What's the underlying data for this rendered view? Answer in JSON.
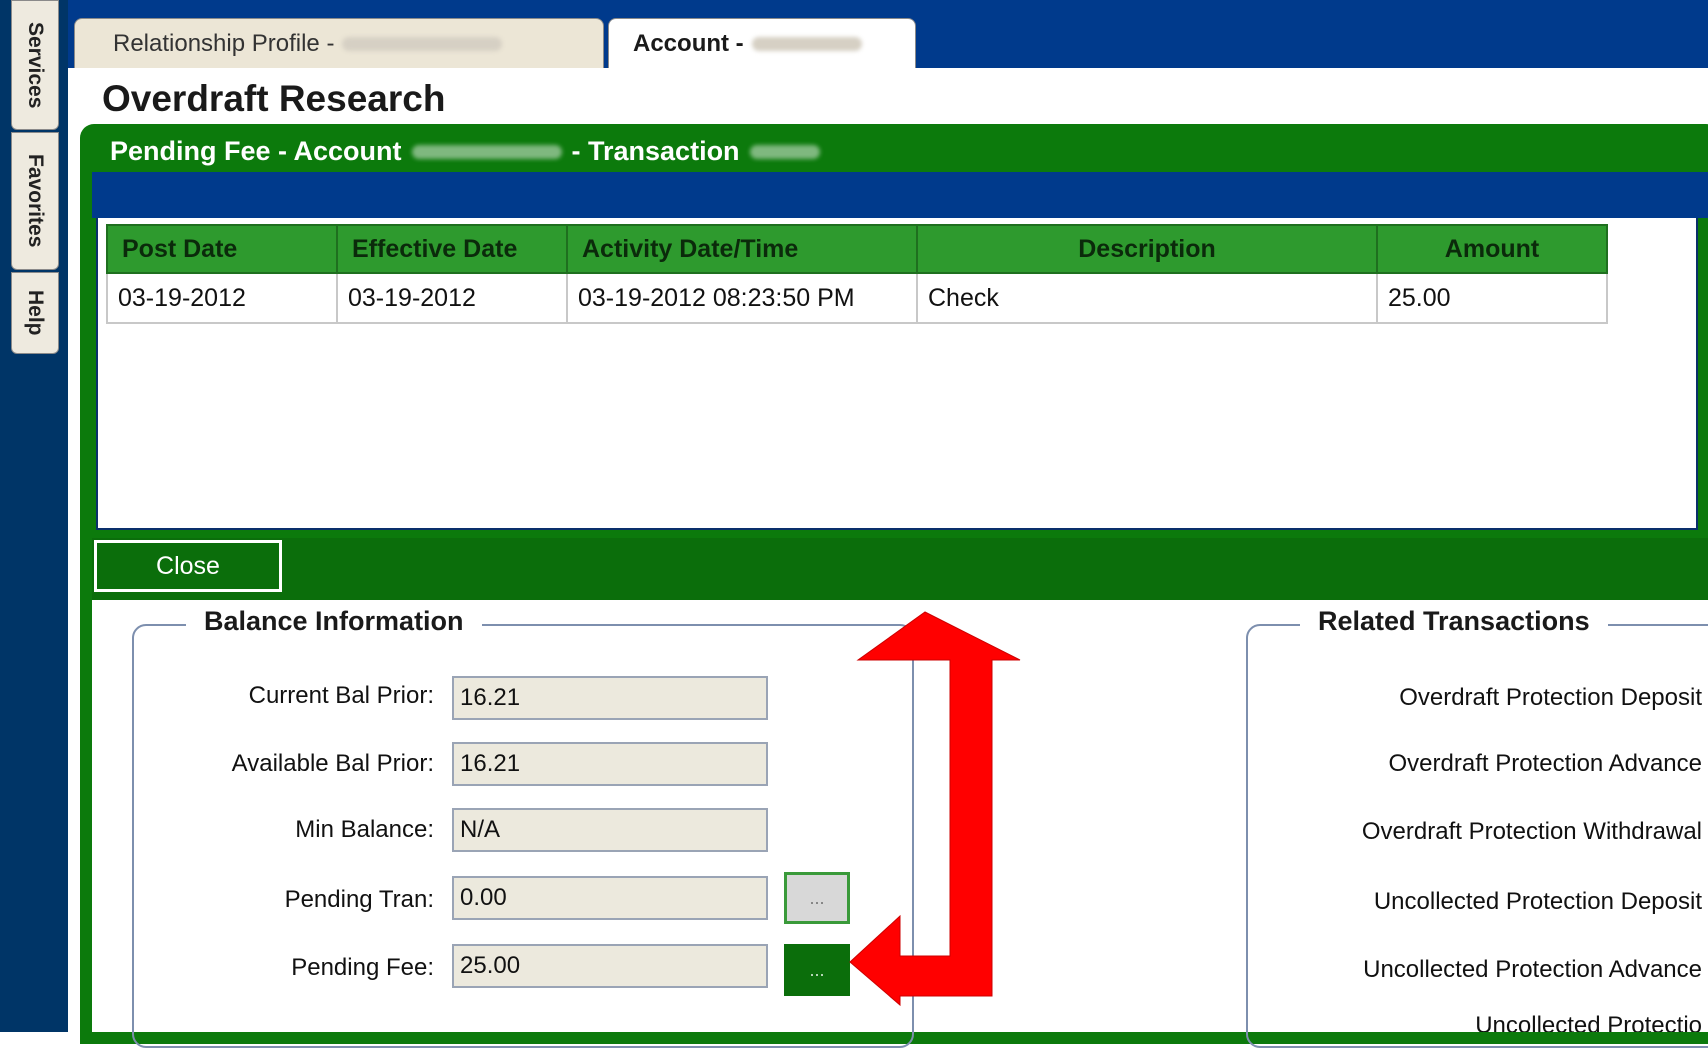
{
  "side_tabs": [
    "Services",
    "Favorites",
    "Help"
  ],
  "top_tabs": {
    "relationship_profile": "Relationship Profile -",
    "account": "Account -"
  },
  "page": {
    "title": "Overdraft Research"
  },
  "panel": {
    "title_prefix": "Pending Fee - Account",
    "title_mid": "- Transaction"
  },
  "table": {
    "headers": [
      "Post Date",
      "Effective Date",
      "Activity Date/Time",
      "Description",
      "Amount"
    ],
    "rows": [
      [
        "03-19-2012",
        "03-19-2012",
        "03-19-2012 08:23:50 PM",
        "Check",
        "25.00"
      ]
    ]
  },
  "close_label": "Close",
  "balance": {
    "legend": "Balance Information",
    "fields": [
      {
        "label": "Current Bal Prior:",
        "value": "16.21"
      },
      {
        "label": "Available Bal Prior:",
        "value": "16.21"
      },
      {
        "label": "Min Balance:",
        "value": "N/A"
      },
      {
        "label": "Pending Tran:",
        "value": "0.00"
      },
      {
        "label": "Pending Fee:",
        "value": "25.00"
      }
    ],
    "ellipsis": "..."
  },
  "related": {
    "legend": "Related Transactions",
    "items": [
      "Overdraft Protection Deposit",
      "Overdraft Protection Advance",
      "Overdraft Protection Withdrawal",
      "Uncollected Protection Deposit",
      "Uncollected Protection Advance",
      "Uncollected Protectio"
    ]
  },
  "annotation": {
    "arrow_color": "#ff0000"
  },
  "colors": {
    "nav_blue": "#003a8c",
    "panel_green": "#0c7a0c",
    "header_green": "#2e9a2e"
  }
}
